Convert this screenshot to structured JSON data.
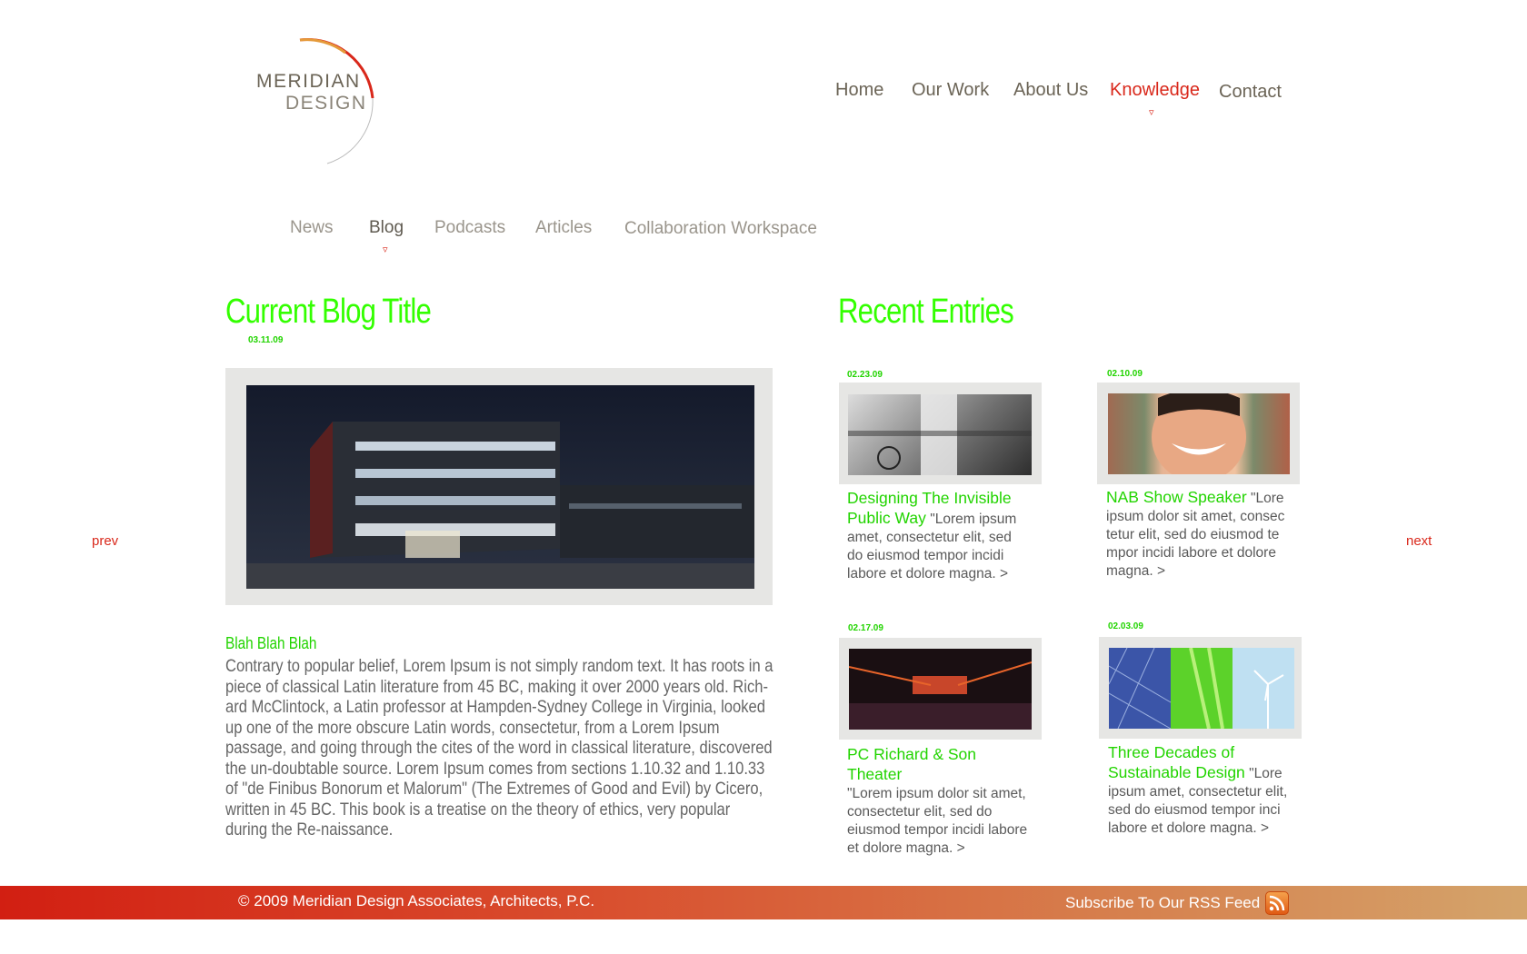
{
  "logo": {
    "line1": "MERIDIAN",
    "line2": "DESIGN"
  },
  "nav": {
    "items": [
      {
        "label": "Home"
      },
      {
        "label": "Our Work"
      },
      {
        "label": "About Us"
      },
      {
        "label": "Knowledge"
      },
      {
        "label": "Contact"
      }
    ],
    "active_index": 3,
    "caret": "▿"
  },
  "subnav": {
    "items": [
      {
        "label": "News"
      },
      {
        "label": "Blog"
      },
      {
        "label": "Podcasts"
      },
      {
        "label": "Articles"
      },
      {
        "label": "Collaboration Workspace"
      }
    ],
    "active_index": 1,
    "caret": "▿"
  },
  "blog": {
    "title": "Current Blog Title",
    "date": "03.11.09",
    "body_title": "Blah Blah Blah",
    "body_text": "Contrary to popular belief, Lorem Ipsum is not simply random text. It has roots in a piece of classical Latin literature from 45 BC, making it over 2000 years old. Rich-ard McClintock, a Latin professor at Hampden-Sydney College in Virginia, looked up one of the more obscure Latin words, consectetur, from a Lorem Ipsum passage, and going through the cites of the word in classical literature, discovered the un-doubtable source. Lorem Ipsum comes from sections 1.10.32 and 1.10.33 of \"de Finibus Bonorum et Malorum\" (The Extremes of Good and Evil) by Cicero, written in 45 BC. This book is a treatise on the theory of ethics, very popular during the Re-naissance."
  },
  "recent": {
    "heading": "Recent Entries",
    "entries": [
      {
        "date": "02.23.09",
        "title": "Designing The Invisible Public Way",
        "text": "\"Lorem ipsum amet, consectetur elit, sed do eiusmod tempor incidi labore et dolore magna.  >"
      },
      {
        "date": "02.10.09",
        "title": "NAB Show Speaker",
        "text": "\"Lore ipsum dolor sit amet, consec tetur elit, sed do eiusmod te mpor incidi labore et dolore magna.  >"
      },
      {
        "date": "02.17.09",
        "title": "PC Richard & Son Theater",
        "text": "\"Lorem ipsum dolor sit amet, consectetur elit, sed do eiusmod tempor incidi labore et dolore magna.  >"
      },
      {
        "date": "02.03.09",
        "title": "Three Decades of Sustainable Design",
        "text": "\"Lore ipsum amet, consectetur elit, sed do eiusmod tempor inci labore et dolore magna.  >"
      }
    ]
  },
  "pager": {
    "prev": "prev",
    "next": "next"
  },
  "footer": {
    "copyright": "© 2009 Meridian Design Associates, Architects, P.C.",
    "rss": "Subscribe To Our RSS Feed"
  },
  "colors": {
    "accent_red": "#d9281b",
    "accent_green": "#33ff00"
  }
}
